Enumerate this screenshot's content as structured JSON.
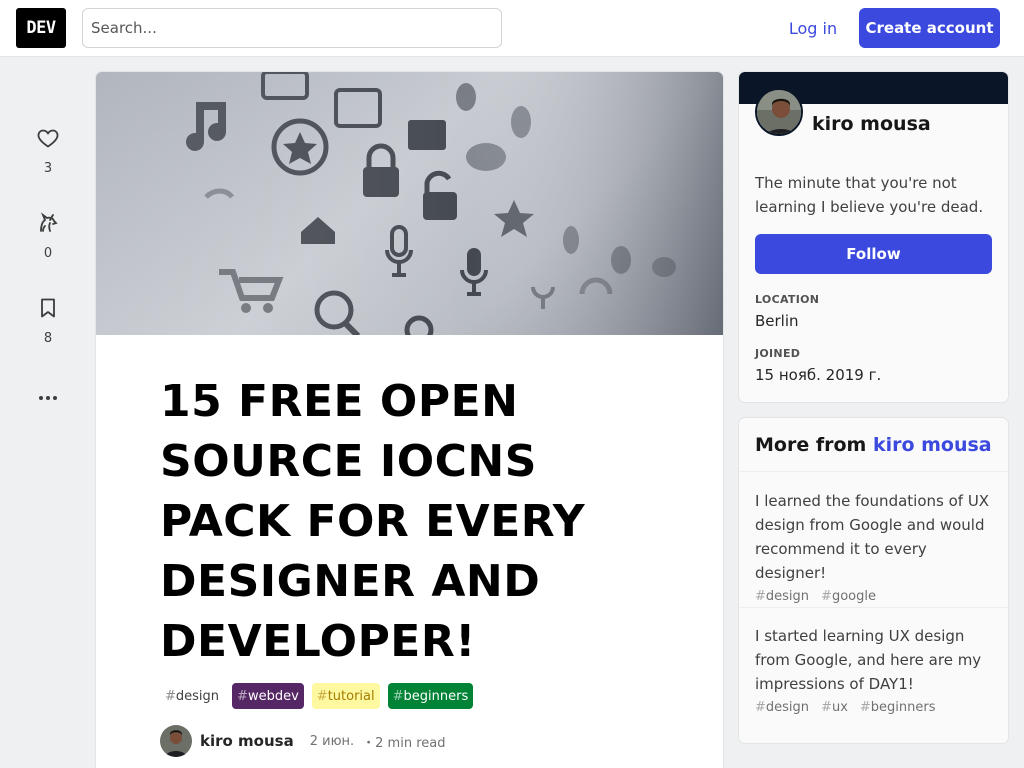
{
  "header": {
    "logo_text": "DEV",
    "search_placeholder": "Search...",
    "login_label": "Log in",
    "create_account_label": "Create account"
  },
  "reactions": [
    {
      "icon": "heart-icon",
      "count": "3"
    },
    {
      "icon": "unicorn-icon",
      "count": "0"
    },
    {
      "icon": "bookmark-icon",
      "count": "8"
    },
    {
      "icon": "more-horizontal-icon",
      "count": ""
    }
  ],
  "article": {
    "cover_icon_set": "icons-illustration",
    "title": "15 FREE OPEN SOURCE IOCNS PACK FOR EVERY DESIGNER AND DEVELOPER!",
    "tags": [
      {
        "label": "design",
        "bg": "#ffffff",
        "color": "#404040"
      },
      {
        "label": "webdev",
        "bg": "#562765",
        "color": "#ffffff"
      },
      {
        "label": "tutorial",
        "bg": "#fef9a1",
        "color": "#a67c00"
      },
      {
        "label": "beginners",
        "bg": "#008335",
        "color": "#ffffff"
      }
    ],
    "author": "kiro mousa",
    "date": "2 июн.",
    "read_time": "・2 min read"
  },
  "profile": {
    "name": "kiro mousa",
    "bio": "The minute that you're not learning I believe you're dead.",
    "follow_label": "Follow",
    "location_label": "LOCATION",
    "location_value": "Berlin",
    "joined_label": "JOINED",
    "joined_value": "15 нояб. 2019 г.",
    "banner_color": "#0a1527"
  },
  "more_from": {
    "heading_prefix": "More from ",
    "heading_author": "kiro mousa",
    "items": [
      {
        "text": "I learned the foundations of UX design from Google and would recommend it to every designer!",
        "tags": [
          "design",
          "google"
        ]
      },
      {
        "text": "I started learning UX design from Google, and here are my impressions of DAY1!",
        "tags": [
          "design",
          "ux",
          "beginners"
        ]
      }
    ]
  },
  "colors": {
    "accent": "#3b49df",
    "page_bg": "#eef0f1"
  }
}
